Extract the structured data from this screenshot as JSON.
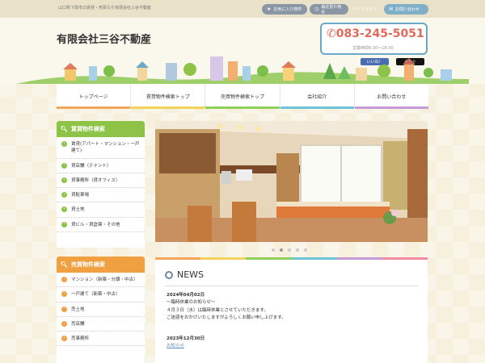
{
  "topbar": {
    "tagline": "山口県下関市の賃貸・売買なら有限会社三谷不動産",
    "favorites_label": "お気に入り物件",
    "recent_label": "最近見た物件",
    "sitemap_label": "サイトマップ",
    "contact_label": "お問い合わせ"
  },
  "header": {
    "company_name": "有限会社三谷不動産",
    "phone": "083-245-5051",
    "hours": "営業時間9:30～18:30",
    "like_label": "いいね！",
    "post_label": "ポスト"
  },
  "nav": {
    "items": [
      {
        "label": "トップページ",
        "color": "#f2a65a"
      },
      {
        "label": "賃貸物件検索トップ",
        "color": "#f2d35a"
      },
      {
        "label": "売買物件検索トップ",
        "color": "#8fcf5a"
      },
      {
        "label": "会社紹介",
        "color": "#6cc4d6"
      },
      {
        "label": "お問い合わせ",
        "color": "#c69ad6"
      }
    ]
  },
  "sidebar": {
    "rent": {
      "title": "賃貸物件検索",
      "items": [
        "賃貸(アパート・マンション・一戸建て)",
        "貸店舗（テナント）",
        "貸事務所（貸オフィス）",
        "貸駐車場",
        "貸土地",
        "貸ビル・貸倉庫・その他"
      ]
    },
    "sale": {
      "title": "売買物件検索",
      "items": [
        "マンション（新築・分譲・中古）",
        "一戸建て（新築・中古）",
        "売土地",
        "売店舗",
        "売事務所"
      ]
    }
  },
  "news": {
    "title": "NEWS",
    "entries": [
      {
        "date": "2024年04月02日",
        "lines": [
          "～臨時休業のお知らせ～",
          "４月３日（水）は臨時休業とさせていただきます。",
          "ご迷惑をおかけいたしますがよろしくお願い申し上げます。"
        ]
      },
      {
        "date": "2023年12月30日",
        "link": "お知らせ"
      }
    ]
  },
  "colors": {
    "rent_green": "#8dc447",
    "sale_orange": "#f0a040",
    "phone_red": "#e06a5a",
    "phone_border": "#6aa8c8"
  }
}
